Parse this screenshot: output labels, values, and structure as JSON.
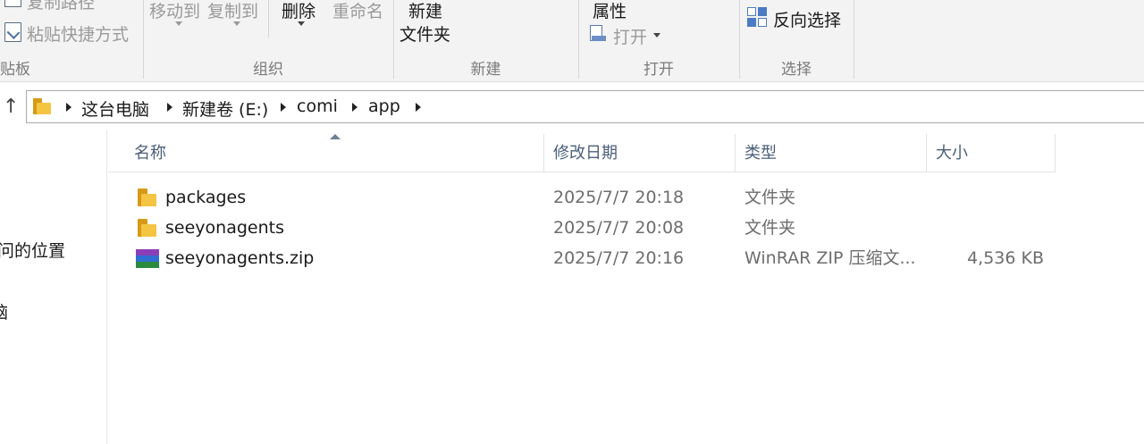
{
  "ribbon": {
    "clipboard": {
      "copy_path_label": "复制路径",
      "paste_shortcut_label": "粘贴快捷方式",
      "group_label": "贴板"
    },
    "organize": {
      "move_to_label": "移动到",
      "copy_to_label": "复制到",
      "delete_label": "删除",
      "rename_label": "重命名",
      "group_label": "组织"
    },
    "new": {
      "new_folder_line1": "新建",
      "new_folder_line2": "文件夹",
      "group_label": "新建"
    },
    "open": {
      "properties_label": "属性",
      "open_label": "打开",
      "group_label": "打开"
    },
    "select": {
      "invert_selection_label": "反向选择",
      "group_label": "选择"
    }
  },
  "address_bar": {
    "breadcrumbs": [
      "这台电脑",
      "新建卷 (E:)",
      "comi",
      "app"
    ]
  },
  "nav_pane": {
    "items": [
      "问的位置",
      "脑"
    ]
  },
  "file_list": {
    "columns": [
      "名称",
      "修改日期",
      "类型",
      "大小"
    ],
    "rows": [
      {
        "name": "packages",
        "date": "2025/7/7 20:18",
        "type": "文件夹",
        "size": "",
        "icon": "folder-icon"
      },
      {
        "name": "seeyonagents",
        "date": "2025/7/7 20:08",
        "type": "文件夹",
        "size": "",
        "icon": "folder-icon"
      },
      {
        "name": "seeyonagents.zip",
        "date": "2025/7/7 20:16",
        "type": "WinRAR ZIP 压缩文...",
        "size": "4,536 KB",
        "icon": "winrar-zip-icon"
      }
    ]
  },
  "colors": {
    "folder_yellow": "#f4c542",
    "folder_dark": "#d79a16",
    "header_text": "#4c607a",
    "muted_text": "#6d6d6d"
  }
}
